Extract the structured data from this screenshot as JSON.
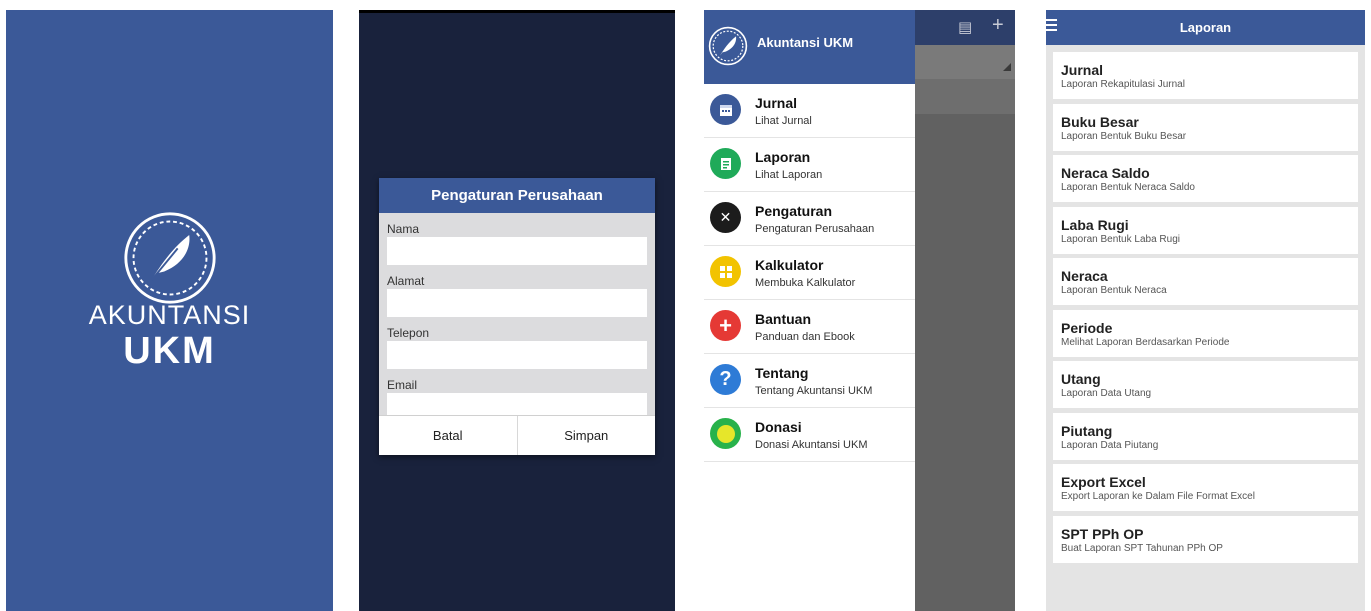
{
  "splash": {
    "logo_line1": "AKUNTANSI",
    "logo_line2": "UKM",
    "logo_icon": "feather-icon",
    "background": "#3b5998"
  },
  "settings_dialog": {
    "title": "Pengaturan Perusahaan",
    "fields": [
      {
        "label": "Nama",
        "value": ""
      },
      {
        "label": "Alamat",
        "value": ""
      },
      {
        "label": "Telepon",
        "value": ""
      },
      {
        "label": "Email",
        "value": ""
      }
    ],
    "cancel_label": "Batal",
    "save_label": "Simpan"
  },
  "drawer": {
    "app_title": "Akuntansi UKM",
    "items": [
      {
        "title": "Jurnal",
        "subtitle": "Lihat Jurnal",
        "icon": "calendar-icon",
        "color": "#3b5998"
      },
      {
        "title": "Laporan",
        "subtitle": "Lihat Laporan",
        "icon": "document-icon",
        "color": "#1faa59"
      },
      {
        "title": "Pengaturan",
        "subtitle": "Pengaturan Perusahaan",
        "icon": "tools-icon",
        "color": "#1c1c1c"
      },
      {
        "title": "Kalkulator",
        "subtitle": "Membuka Kalkulator",
        "icon": "calculator-icon",
        "color": "#f2c300"
      },
      {
        "title": "Bantuan",
        "subtitle": "Panduan dan Ebook",
        "icon": "plus-icon",
        "color": "#e53935"
      },
      {
        "title": "Tentang",
        "subtitle": "Tentang Akuntansi UKM",
        "icon": "question-icon",
        "color": "#2e7bd6"
      },
      {
        "title": "Donasi",
        "subtitle": "Donasi Akuntansi UKM",
        "icon": "coin-icon",
        "color": "#28b24b"
      }
    ]
  },
  "reports": {
    "title": "Laporan",
    "items": [
      {
        "title": "Jurnal",
        "subtitle": "Laporan Rekapitulasi Jurnal"
      },
      {
        "title": "Buku Besar",
        "subtitle": "Laporan Bentuk Buku Besar"
      },
      {
        "title": "Neraca Saldo",
        "subtitle": "Laporan Bentuk Neraca Saldo"
      },
      {
        "title": "Laba Rugi",
        "subtitle": "Laporan Bentuk Laba Rugi"
      },
      {
        "title": "Neraca",
        "subtitle": "Laporan Bentuk Neraca"
      },
      {
        "title": "Periode",
        "subtitle": "Melihat Laporan Berdasarkan Periode"
      },
      {
        "title": "Utang",
        "subtitle": "Laporan Data Utang"
      },
      {
        "title": "Piutang",
        "subtitle": "Laporan Data Piutang"
      },
      {
        "title": "Export Excel",
        "subtitle": "Export Laporan ke Dalam File Format Excel"
      },
      {
        "title": "SPT PPh OP",
        "subtitle": "Buat Laporan SPT Tahunan PPh OP"
      }
    ]
  }
}
